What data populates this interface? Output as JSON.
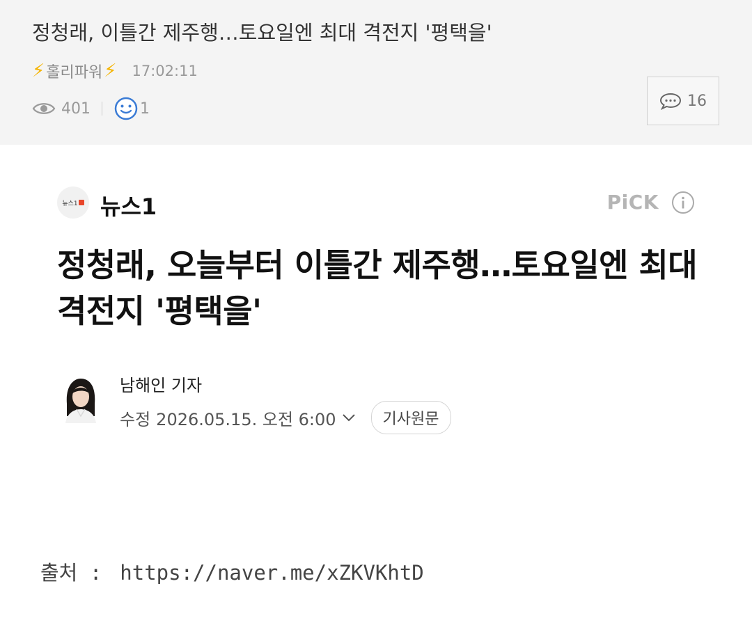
{
  "post": {
    "title": "정청래, 이틀간 제주행…토요일엔 최대 격전지 '평택을'",
    "author": "홀리파워",
    "bolt_left": "⚡",
    "bolt_right": "⚡",
    "time": "17:02:11",
    "views": "401",
    "reactions": "1",
    "comments": "16"
  },
  "article": {
    "press_name": "뉴스1",
    "press_logo_text": "뉴스1",
    "pick_label": "PiCK",
    "headline": "정청래, 오늘부터 이틀간 제주행…토요일엔 최대 격전지 '평택을'",
    "reporter": "남해인 기자",
    "modified_label": "수정",
    "modified_datetime": "2026.05.15. 오전 6:00",
    "original_button": "기사원문"
  },
  "source": {
    "label": "출처 :",
    "url": "https://naver.me/xZKVKhtD"
  },
  "colors": {
    "header_bg": "#f4f4f4",
    "bolt": "#f5b400",
    "logo_mark": "#e8462a",
    "smile": "#3a7bd5"
  }
}
